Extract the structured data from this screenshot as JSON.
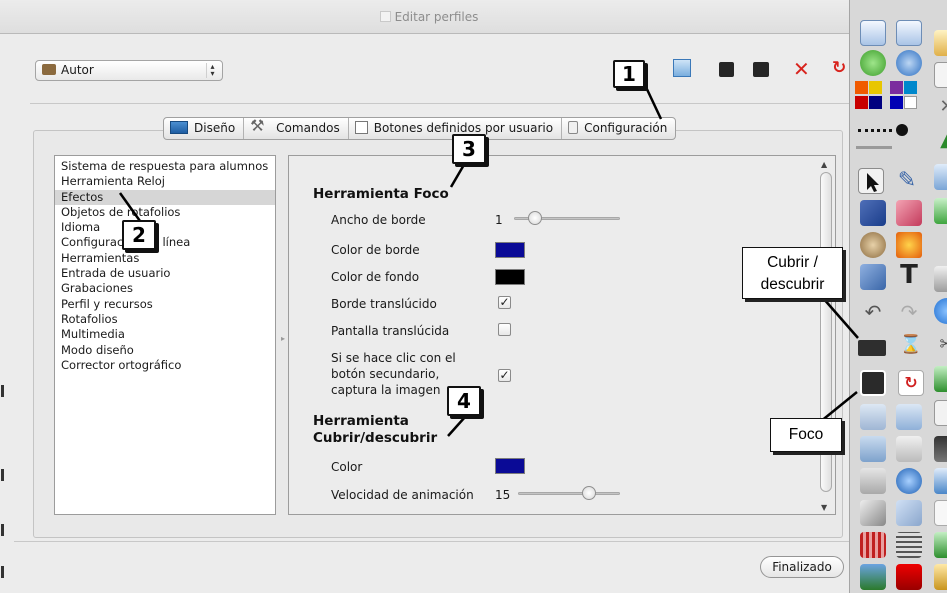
{
  "window": {
    "title": "Editar perfiles"
  },
  "profile": {
    "label": "Autor"
  },
  "tabs": [
    {
      "label": "Diseño"
    },
    {
      "label": "Comandos"
    },
    {
      "label": "Botones definidos por usuario"
    },
    {
      "label": "Configuración"
    }
  ],
  "categories": [
    "Sistema de respuesta para alumnos",
    "Herramienta Reloj",
    "Efectos",
    "Objetos de rotafolios",
    "Idioma",
    "Configuración de línea",
    "Herramientas",
    "Entrada de usuario",
    "Grabaciones",
    "Perfil y recursos",
    "Rotafolios",
    "Multimedia",
    "Modo diseño",
    "Corrector ortográfico"
  ],
  "selected_category": "Efectos",
  "panel": {
    "spotlight": {
      "heading": "Herramienta Foco",
      "border_width_label": "Ancho de borde",
      "border_width_value": "1",
      "border_color_label": "Color de borde",
      "border_color": "#0a0a96",
      "background_color_label": "Color de fondo",
      "background_color": "#000000",
      "translucent_border_label": "Borde translúcido",
      "translucent_border_checked": true,
      "translucent_screen_label": "Pantalla translúcida",
      "translucent_screen_checked": false,
      "right_click_label_1": "Si se hace clic con el",
      "right_click_label_2": "botón secundario,",
      "right_click_label_3": "captura la imagen",
      "right_click_checked": true
    },
    "reveal": {
      "heading_1": "Herramienta",
      "heading_2": "Cubrir/descubrir",
      "color_label": "Color",
      "color": "#0a0a96",
      "speed_label": "Velocidad de animación",
      "speed_value": "15"
    }
  },
  "buttons": {
    "finish": "Finalizado"
  },
  "callouts": {
    "c1": "1",
    "c2": "2",
    "c3": "3",
    "c4": "4",
    "reveal_line1": "Cubrir /",
    "reveal_line2": "descubrir",
    "spotlight": "Foco"
  },
  "icons": {
    "toolbar": [
      "import-profile-icon",
      "save-icon",
      "save-as-icon",
      "delete-icon",
      "reset-icon"
    ],
    "palette_colors": [
      "#f05a00",
      "#e8c600",
      "#7b2c9e",
      "#0088cc",
      "#c80000",
      "#000080",
      "#0000b4",
      "#009a00"
    ]
  }
}
